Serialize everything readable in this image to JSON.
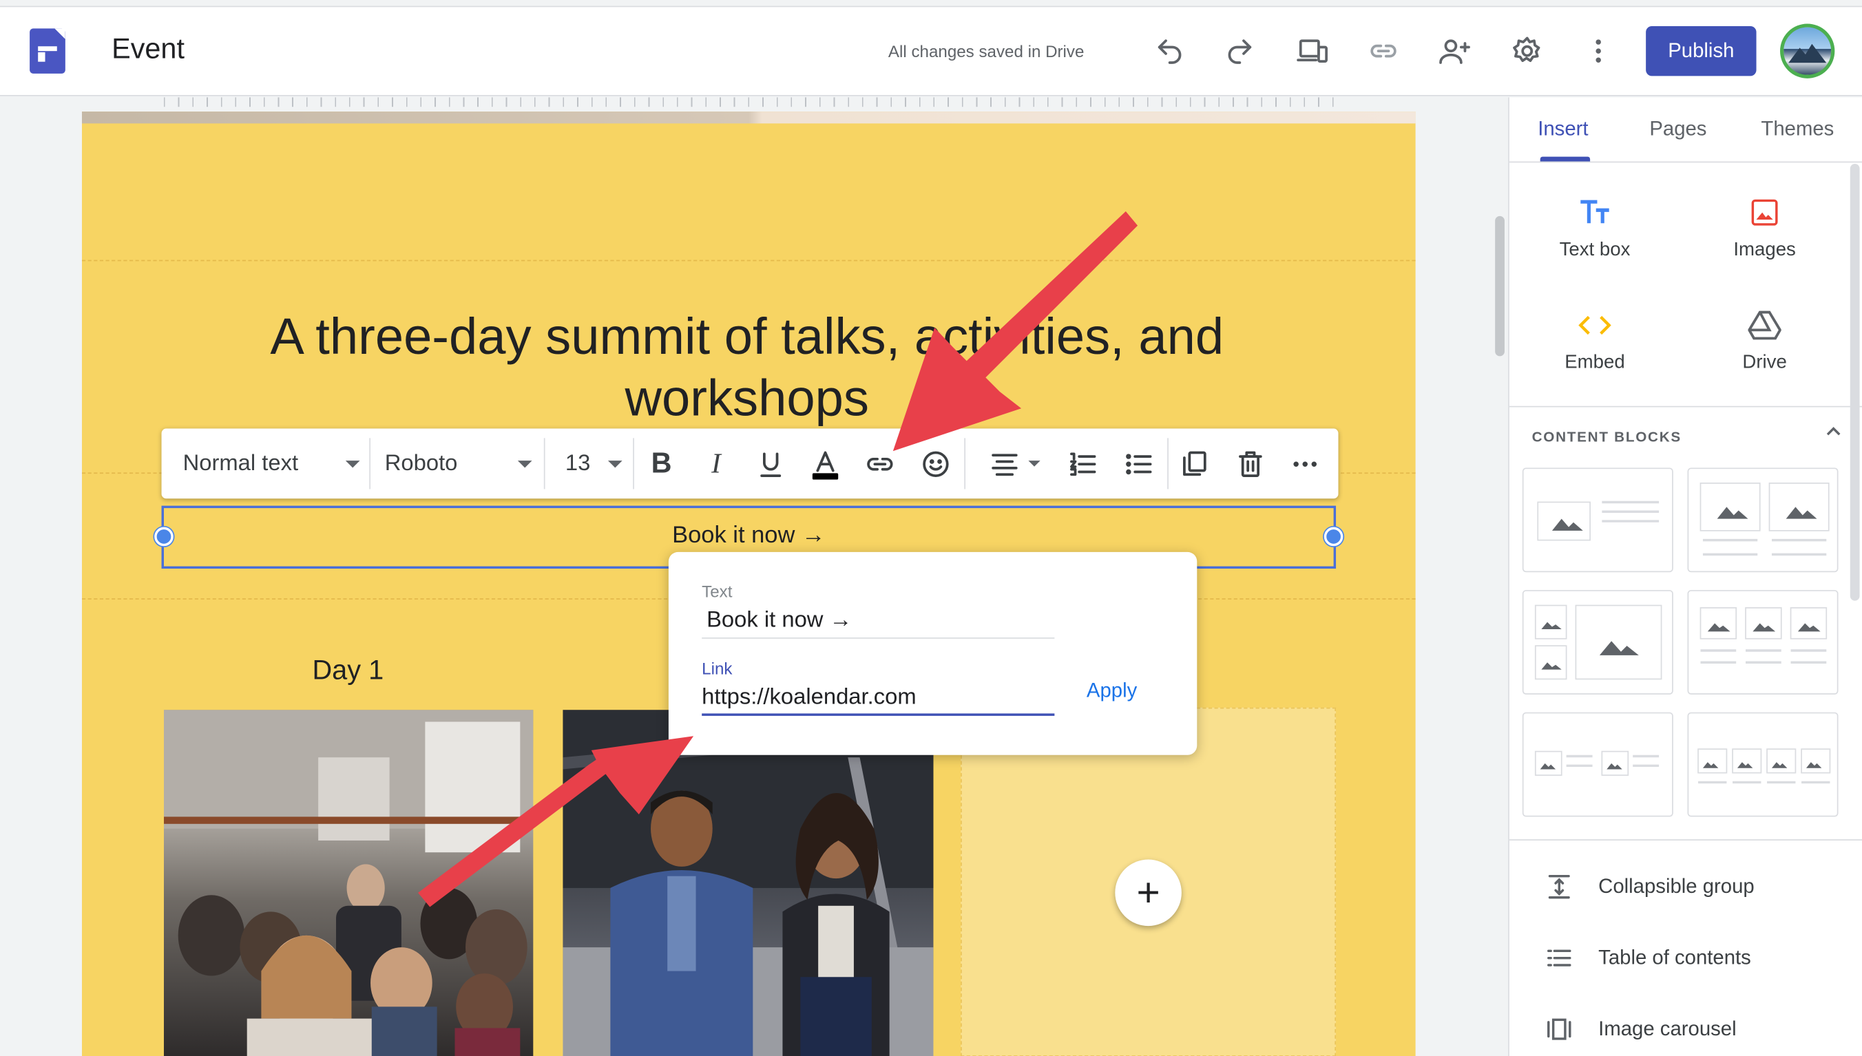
{
  "header": {
    "title": "Event",
    "status": "All changes saved in Drive",
    "publish_label": "Publish",
    "icons": [
      "undo-icon",
      "redo-icon",
      "preview-icon",
      "link-icon",
      "share-icon",
      "settings-icon",
      "more-icon"
    ]
  },
  "canvas": {
    "headline": "A three-day summit of talks, activities, and workshops",
    "button_text": "Book it now →",
    "day_label": "Day 1",
    "colors": {
      "background": "#f7d463",
      "placeholder": "#f9e08e"
    }
  },
  "toolbar": {
    "style_value": "Normal text",
    "font_value": "Roboto",
    "size_value": "13",
    "icons": [
      "bold-icon",
      "italic-icon",
      "underline-icon",
      "text-color-icon",
      "link-icon",
      "emoji-icon",
      "align-icon",
      "numbered-list-icon",
      "bulleted-list-icon",
      "duplicate-icon",
      "delete-icon",
      "more-icon"
    ]
  },
  "link_popup": {
    "text_label": "Text",
    "text_value": "Book it now →",
    "link_label": "Link",
    "link_value": "https://koalendar.com",
    "apply_label": "Apply"
  },
  "panel": {
    "tabs": [
      {
        "label": "Insert",
        "active": true
      },
      {
        "label": "Pages",
        "active": false
      },
      {
        "label": "Themes",
        "active": false
      }
    ],
    "insert_items": [
      {
        "label": "Text box",
        "icon": "text-box-icon"
      },
      {
        "label": "Images",
        "icon": "images-icon"
      },
      {
        "label": "Embed",
        "icon": "embed-icon"
      },
      {
        "label": "Drive",
        "icon": "drive-icon"
      }
    ],
    "content_blocks_title": "CONTENT BLOCKS",
    "list_items": [
      {
        "label": "Collapsible group",
        "icon": "collapsible-group-icon"
      },
      {
        "label": "Table of contents",
        "icon": "table-of-contents-icon"
      },
      {
        "label": "Image carousel",
        "icon": "image-carousel-icon"
      }
    ]
  },
  "colors": {
    "accent": "#3f51b5",
    "selection": "#4a86e8",
    "arrow": "#e8404a"
  }
}
